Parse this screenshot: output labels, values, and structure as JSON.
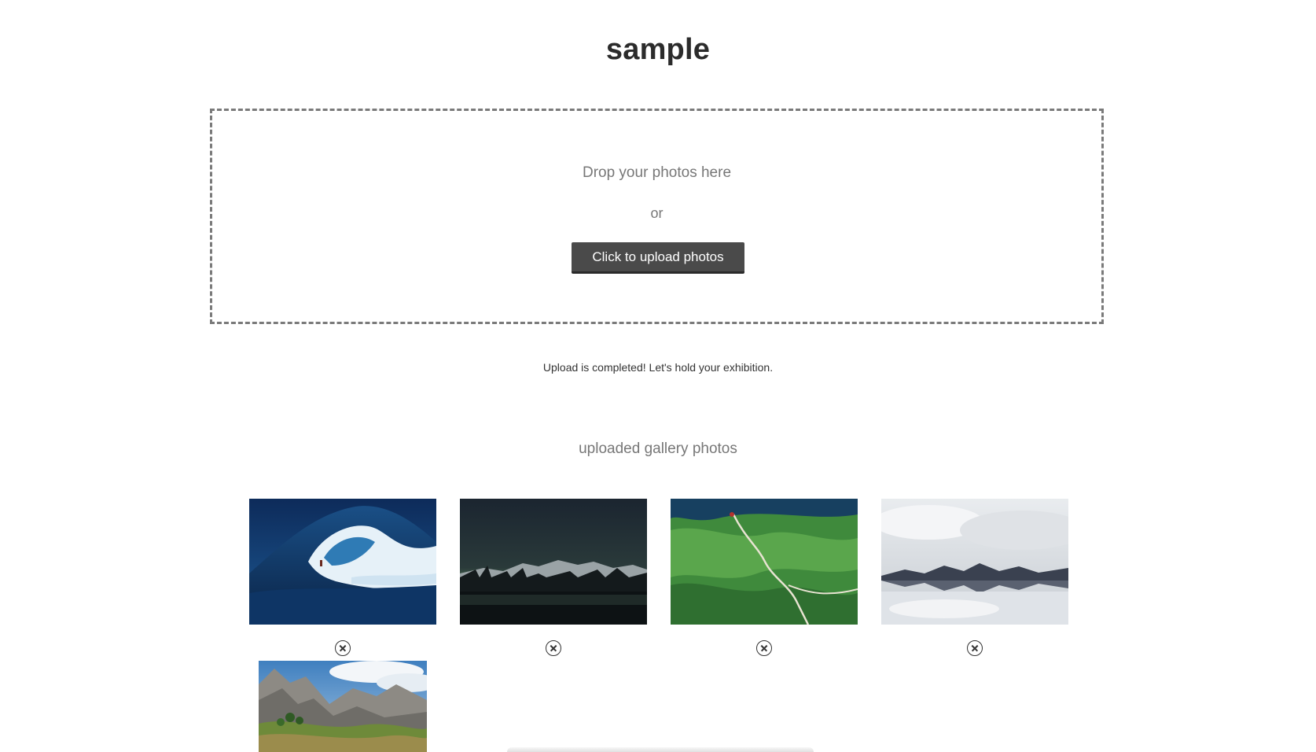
{
  "page": {
    "title": "sample"
  },
  "dropzone": {
    "drop_text": "Drop your photos here",
    "or_text": "or",
    "upload_button_label": "Click to upload photos"
  },
  "status": {
    "message": "Upload is completed! Let's hold your exhibition."
  },
  "gallery": {
    "heading": "uploaded gallery photos",
    "photos": [
      {
        "subject": "ocean wave with surfer",
        "removable": true
      },
      {
        "subject": "aurora over dark mountains and lake",
        "removable": true
      },
      {
        "subject": "green hills with winding road",
        "removable": true
      },
      {
        "subject": "cloudy lake reflecting snowy mountains",
        "removable": true
      },
      {
        "subject": "rocky mountains with green valley",
        "removable": false
      }
    ]
  },
  "icons": {
    "remove": "close-circle-icon"
  }
}
